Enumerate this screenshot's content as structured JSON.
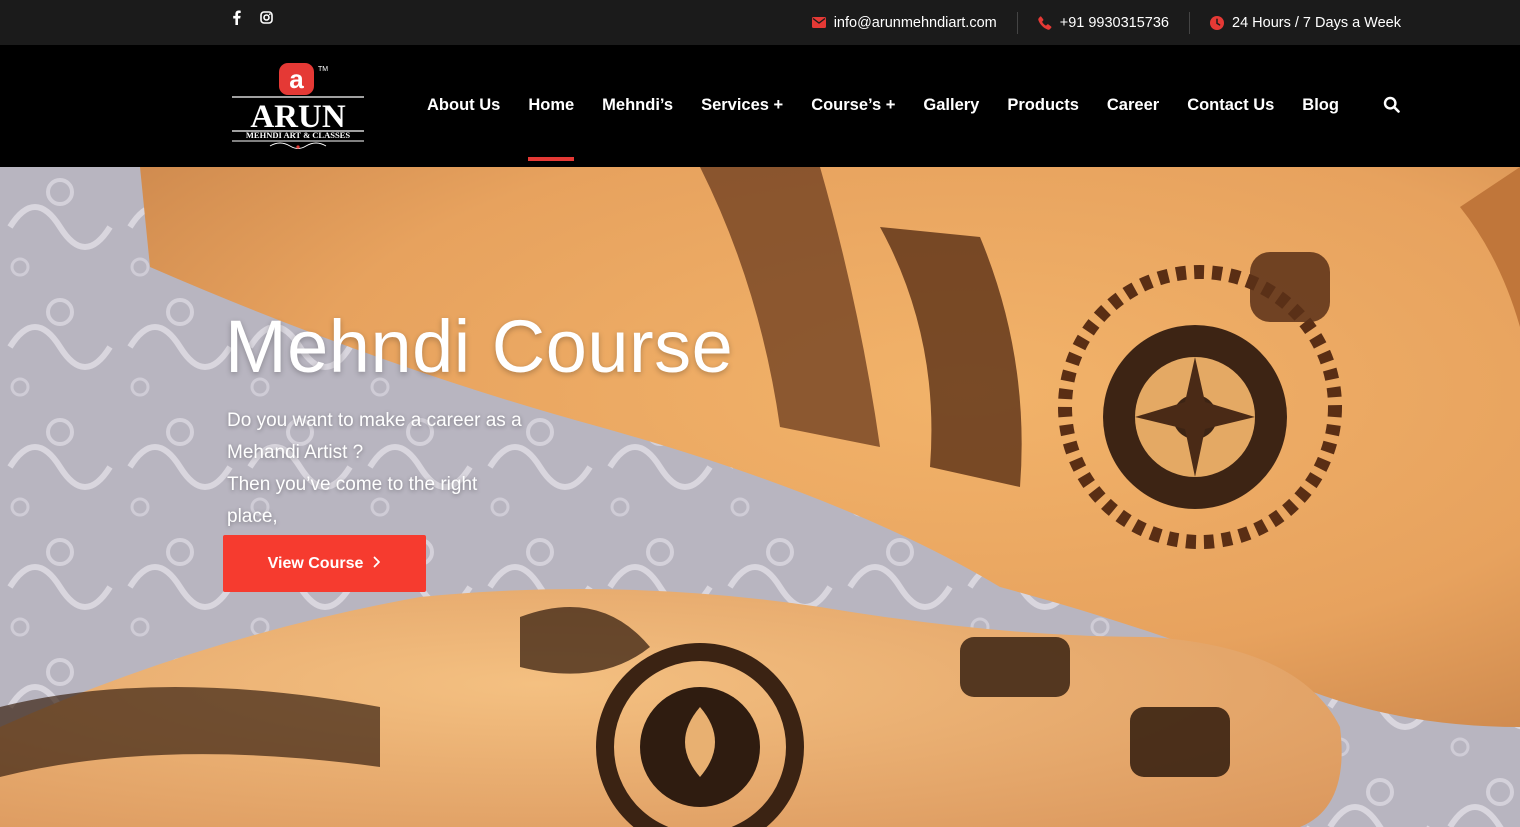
{
  "topbar": {
    "social": [
      {
        "icon": "facebook-icon"
      },
      {
        "icon": "instagram-icon"
      }
    ],
    "email": "info@arunmehndiart.com",
    "phone": "+91 9930315736",
    "hours": "24 Hours / 7 Days a Week",
    "icon_color": "#e53935"
  },
  "logo": {
    "letter": "a",
    "tm": "TM",
    "name": "ARUN",
    "tagline": "MEHNDI ART & CLASSES"
  },
  "nav": {
    "items": [
      {
        "label": "About Us"
      },
      {
        "label": "Home",
        "active": true
      },
      {
        "label": "Mehndi’s"
      },
      {
        "label": "Services +"
      },
      {
        "label": "Course’s +"
      },
      {
        "label": "Gallery"
      },
      {
        "label": "Products"
      },
      {
        "label": "Career"
      },
      {
        "label": "Contact Us"
      },
      {
        "label": "Blog"
      }
    ],
    "search_icon": "search-icon",
    "active_color": "#e53935"
  },
  "hero": {
    "title": "Mehndi Course",
    "lines": [
      "Do you want to make a career as a",
      "Mehandi Artist ?",
      "Then you’ve come to the right",
      "place,"
    ],
    "button_label": "View Course",
    "button_icon": "chevron-right-icon",
    "button_color": "#f63b2f"
  }
}
